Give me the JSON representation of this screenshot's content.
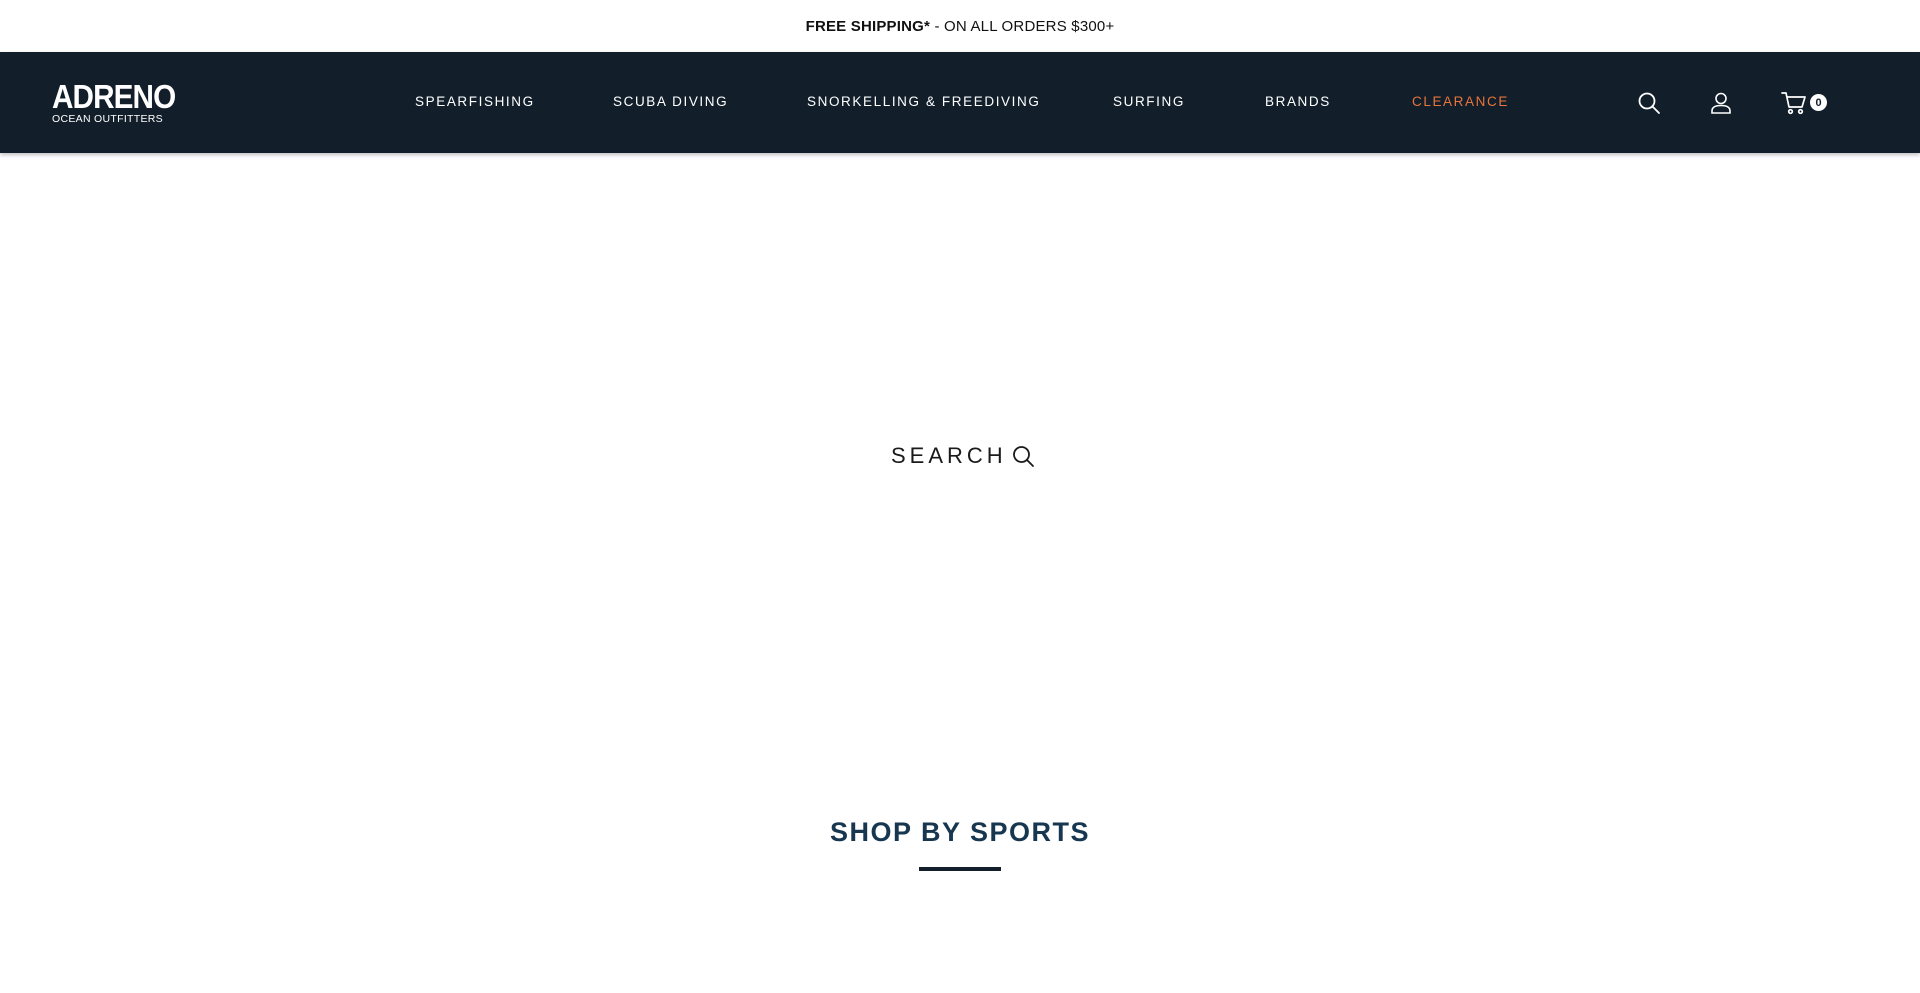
{
  "announcement": {
    "bold": "FREE SHIPPING*",
    "rest": " - ON ALL ORDERS $300+"
  },
  "header": {
    "logo_main": "ADRENO",
    "logo_sub": "OCEAN OUTFITTERS",
    "nav": [
      {
        "label": "SPEARFISHING"
      },
      {
        "label": "SCUBA DIVING"
      },
      {
        "label": "SNORKELLING & FREEDIVING"
      },
      {
        "label": "SURFING"
      },
      {
        "label": "BRANDS"
      },
      {
        "label": "CLEARANCE",
        "color": "#e8743b"
      }
    ],
    "icons": [
      "search-icon",
      "account-icon",
      "cart-icon"
    ],
    "cart_count": "0",
    "background": "#121f2b"
  },
  "hero": {
    "search_label": "SEARCH"
  },
  "sections": {
    "shop_by_sports_title": "SHOP BY SPORTS"
  },
  "colors": {
    "accent": "#e8743b",
    "title": "#17364f"
  }
}
